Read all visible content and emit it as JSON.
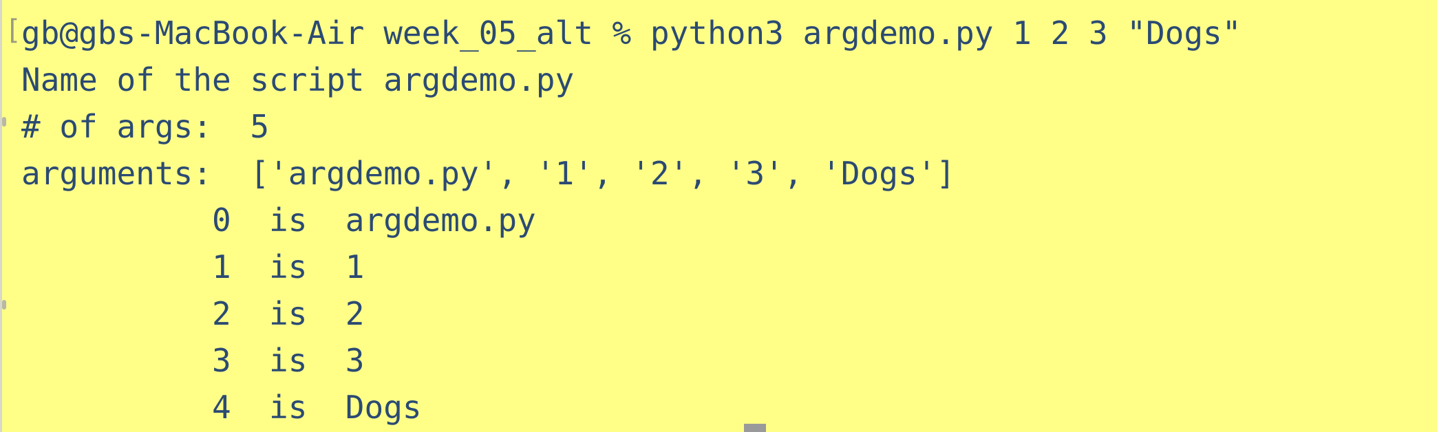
{
  "terminal": {
    "background_color": "#ffff88",
    "text_color": "#2b4a73",
    "cursor_color": "#9a9a9a",
    "lines": [
      "gb@gbs-MacBook-Air week_05_alt % python3 argdemo.py 1 2 3 \"Dogs\"",
      "Name of the script argdemo.py",
      "# of args:  5",
      "arguments:  ['argdemo.py', '1', '2', '3', 'Dogs']",
      "          0  is  argdemo.py",
      "          1  is  1",
      "          2  is  2",
      "          3  is  3",
      "          4  is  Dogs"
    ]
  }
}
